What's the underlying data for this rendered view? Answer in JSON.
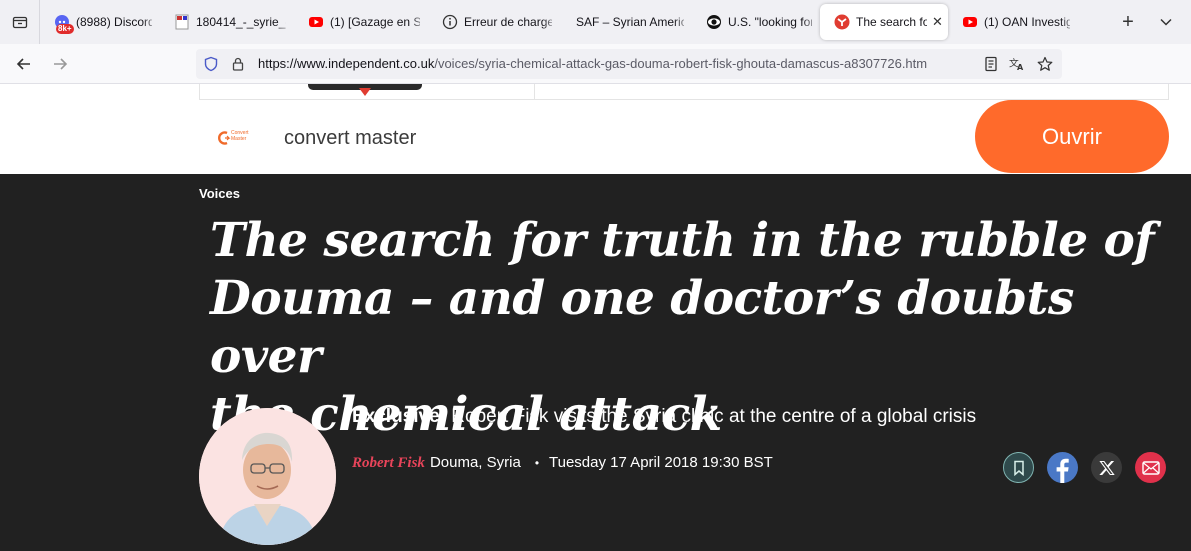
{
  "browser": {
    "tabs": [
      {
        "label": "(8988) Discord | ",
        "icon": "discord-icon"
      },
      {
        "label": "180414_-_syrie_-_",
        "icon": "document-icon"
      },
      {
        "label": "(1) [Gazage en Sy",
        "icon": "youtube-icon"
      },
      {
        "label": "Erreur de charge",
        "icon": "info-icon"
      },
      {
        "label": "SAF – Syrian Americ",
        "icon": ""
      },
      {
        "label": "U.S. \"looking for",
        "icon": "cbs-eye-icon"
      },
      {
        "label": "The search for",
        "icon": "independent-icon",
        "active": true
      },
      {
        "label": "(1) OAN Investig",
        "icon": "youtube-icon"
      }
    ],
    "discord_badge": "8k+",
    "url_host": "https://www.independent.co.uk",
    "url_path": "/voices/syria-chemical-attack-gas-douma-robert-fisk-ghouta-damascus-a8307726.htm"
  },
  "ad": {
    "logo_line1": "Convert",
    "logo_line2": "Master",
    "name": "convert master",
    "cta": "Ouvrir",
    "cta_color": "#ff6a2b"
  },
  "article": {
    "section": "Voices",
    "headline_lines": [
      "The search for truth in the rubble of",
      "Douma – and one doctor’s doubts over",
      "the chemical attack"
    ],
    "standfirst_prefix": "Exclusive:",
    "standfirst_text": " Robert Fisk visits the Syria clinic at the centre of a global crisis",
    "author": "Robert Fisk",
    "location": "Douma, Syria",
    "separator": "•",
    "date": "Tuesday 17 April 2018 19:30 BST",
    "background": "#212121"
  },
  "share": [
    {
      "name": "bookmark",
      "icon": "bookmark-icon",
      "color": "#2f4a4c"
    },
    {
      "name": "facebook",
      "icon": "facebook-icon",
      "color": "#4a78c6"
    },
    {
      "name": "x",
      "icon": "x-icon",
      "color": "#3a3a3a"
    },
    {
      "name": "email",
      "icon": "email-icon",
      "color": "#e0314b"
    }
  ]
}
